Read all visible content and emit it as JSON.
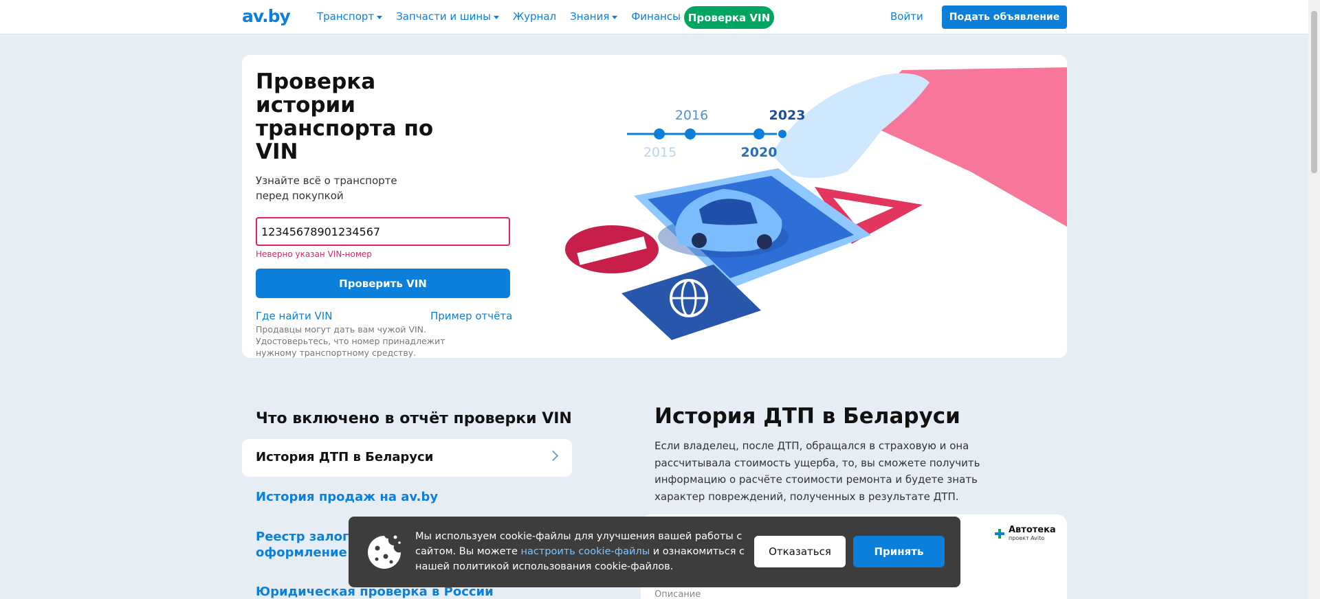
{
  "header": {
    "logo": "av.by",
    "nav": [
      {
        "label": "Транспорт",
        "dropdown": true
      },
      {
        "label": "Запчасти и шины",
        "dropdown": true
      },
      {
        "label": "Журнал",
        "dropdown": false
      },
      {
        "label": "Знания",
        "dropdown": true
      },
      {
        "label": "Финансы",
        "dropdown": false
      }
    ],
    "vin_pill": "Проверка VIN",
    "login": "Войти",
    "post_ad": "Подать объявление"
  },
  "hero": {
    "title": "Проверка истории транспорта по VIN",
    "subtitle": "Узнайте всё о транспорте перед покупкой",
    "vin_value": "12345678901234567",
    "error": "Неверно указан VIN-номер",
    "check_button": "Проверить VIN",
    "where_vin": "Где найти VIN",
    "sample_report": "Пример отчёта",
    "hint": "Продавцы могут дать вам чужой VIN. Удостоверьтесь, что номер принадлежит нужному транспортному средству.",
    "timeline": {
      "y2015": "2015",
      "y2016": "2016",
      "y2020": "2020",
      "y2023": "2023"
    }
  },
  "report": {
    "title": "Что включено в отчёт проверки VIN",
    "active_item": "История ДТП в Беларуси",
    "items": [
      "История продаж на av.by",
      "Реестр залог",
      "оформление в",
      "Юридическая проверка в России"
    ]
  },
  "detail": {
    "title": "История ДТП в Беларуси",
    "text": "Если владелец, после ДТП, обращался в страховую и она рассчитывала стоимость ущерба, то, вы сможете получить информацию о расчёте стоимости ремонта и будете знать характер повреждений, полученных в результате ДТП.",
    "brand": "Автотека",
    "brand_sub": "проект Avito",
    "label": "Описание"
  },
  "cookie": {
    "text_1": "Мы используем cookie-файлы для улучшения вашей работы с сайтом. Вы можете ",
    "link": "настроить cookie-файлы",
    "text_2": " и ознакомиться с нашей политикой использования cookie-файлов.",
    "decline": "Отказаться",
    "accept": "Принять"
  },
  "colors": {
    "brand_blue": "#0b7fda",
    "green": "#00a65f",
    "error": "#e0245e",
    "pink": "#f7779a"
  }
}
